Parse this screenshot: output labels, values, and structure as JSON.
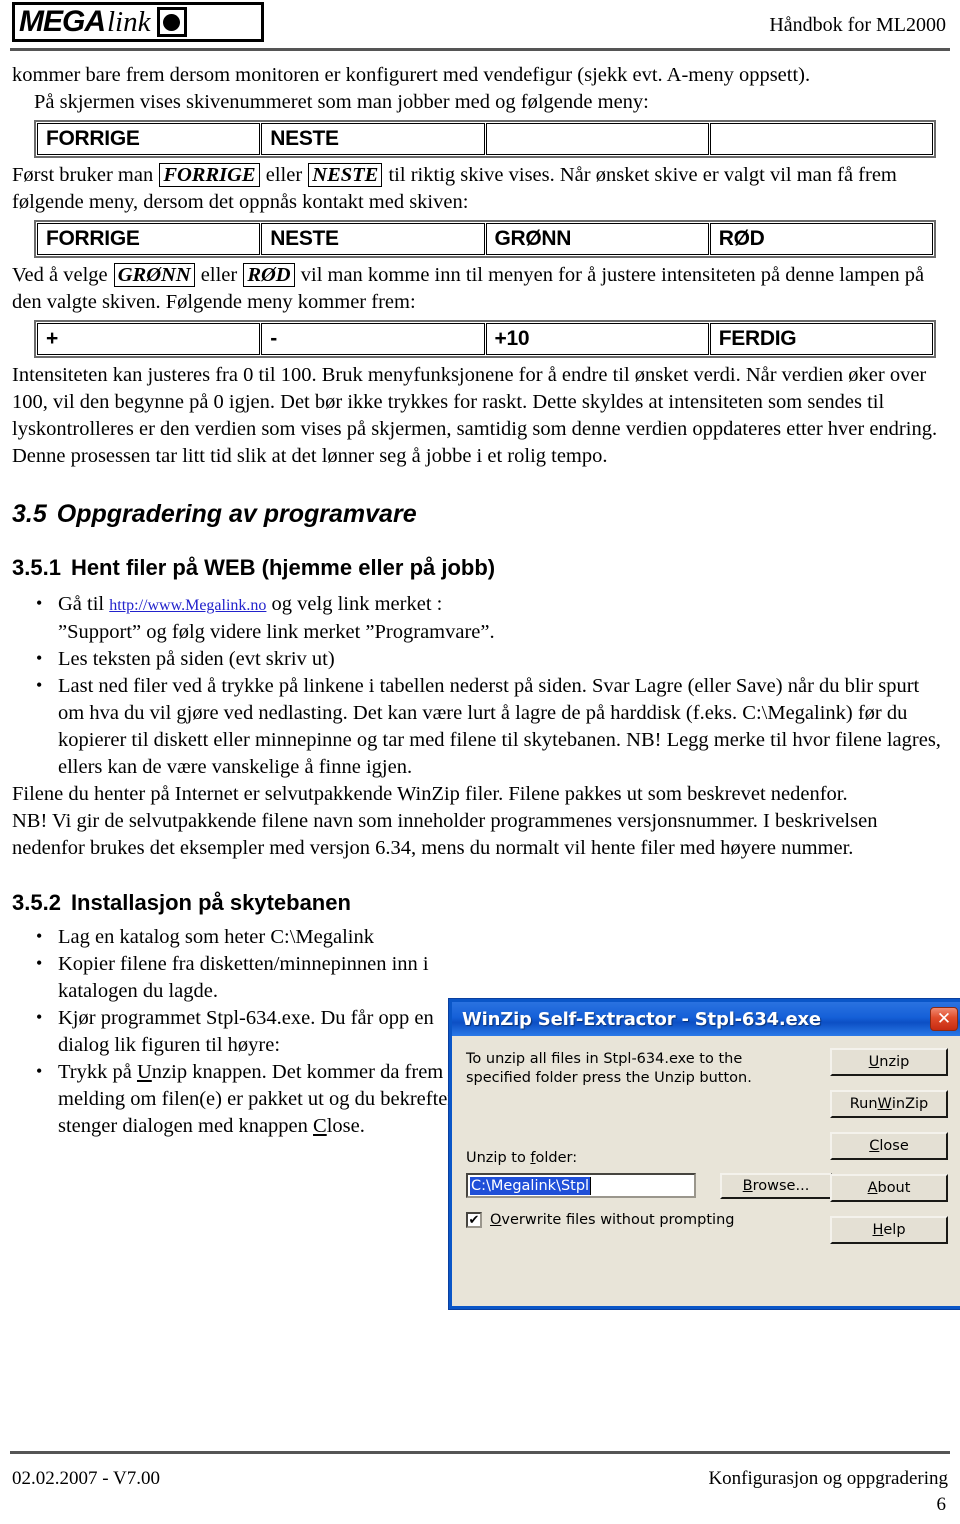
{
  "header": {
    "logo_mega": "MEGA",
    "logo_link": "link",
    "logo_mark_name": "filled-circle-mark",
    "right_text": "Håndbok for ML2000"
  },
  "intro": {
    "line1": "kommer bare frem dersom monitoren er konfigurert med vendefigur (sjekk evt. A-meny oppsett).",
    "line2": "På skjermen vises skivenummeret som man jobber med og følgende meny:"
  },
  "menu_table_1": {
    "cells": [
      "FORRIGE",
      "NESTE",
      "",
      ""
    ]
  },
  "para_after_table1": {
    "pre": "Først bruker man ",
    "box1": "FORRIGE",
    "mid": " eller ",
    "box2": "NESTE",
    "post": " til riktig skive vises. Når ønsket skive er valgt vil man få frem følgende meny, dersom det oppnås kontakt med skiven:"
  },
  "menu_table_2": {
    "cells": [
      "FORRIGE",
      "NESTE",
      "GRØNN",
      "RØD"
    ]
  },
  "para_after_table2": {
    "pre": "Ved å velge ",
    "box1": "GRØNN",
    "mid": " eller ",
    "box2": "RØD",
    "post": " vil man komme inn til menyen for å justere intensiteten på denne lampen på den valgte skiven. Følgende meny kommer frem:"
  },
  "menu_table_3": {
    "cells": [
      "+",
      "-",
      "+10",
      "FERDIG"
    ]
  },
  "para_after_table3": "Intensiteten kan justeres fra 0 til 100. Bruk menyfunksjonene for å endre til ønsket verdi. Når verdien øker over 100, vil den begynne på 0 igjen. Det bør ikke trykkes for raskt. Dette skyldes at intensiteten som sendes til lyskontrolleres er den verdien som vises på skjermen, samtidig som denne verdien oppdateres etter hver endring. Denne prosessen tar litt tid slik at det lønner seg å jobbe i et rolig tempo.",
  "section_35": {
    "number": "3.5",
    "title": "Oppgradering av programvare"
  },
  "section_351": {
    "number": "3.5.1",
    "title": "Hent filer på WEB (hjemme eller på jobb)",
    "bullet1_pre": "Gå til ",
    "bullet1_link": "http://www.Megalink.no",
    "bullet1_post": " og velg link merket :",
    "bullet1_line2": "”Support” og følg videre link merket ”Programvare”.",
    "bullet2": "Les teksten på siden (evt skriv ut)",
    "bullet3": "Last ned filer ved å trykke på linkene i tabellen nederst på siden. Svar Lagre (eller Save) når du blir spurt om hva du vil gjøre ved nedlasting. Det kan være lurt å lagre de på harddisk (f.eks. C:\\Megalink) før du kopierer til diskett eller minnepinne og tar med filene til skytebanen. NB! Legg merke til hvor filene lagres, ellers kan de være vanskelige å finne igjen.",
    "para1": "Filene du henter på Internet er selvutpakkende WinZip filer. Filene pakkes ut som beskrevet nedenfor.",
    "para2": "NB! Vi gir de selvutpakkende filene navn som inneholder programmenes versjonsnummer. I beskrivelsen nedenfor brukes det eksempler med versjon 6.34, mens du normalt vil hente filer med høyere nummer."
  },
  "section_352": {
    "number": "3.5.2",
    "title": "Installasjon på skytebanen",
    "bullet1": "Lag en katalog som heter C:\\Megalink",
    "bullet2": "Kopier filene fra disketten/minnepinnen inn i katalogen du lagde.",
    "bullet3": "Kjør programmet Stpl-634.exe. Du får opp en dialog lik figuren til høyre:",
    "bullet4_pre": "Trykk på ",
    "bullet4_u1": "U",
    "bullet4_mid": "nzip knappen. Det kommer da frem en melding om filen(e) er pakket ut og du bekrefter og stenger dialogen med knappen ",
    "bullet4_u2": "C",
    "bullet4_post": "lose."
  },
  "winzip_dialog": {
    "title": "WinZip Self-Extractor - Stpl-634.exe",
    "close_label": "✕",
    "message": "To unzip all files in Stpl-634.exe to the specified folder press the Unzip button.",
    "folder_label_u": "f",
    "folder_label_pre": "Unzip to ",
    "folder_label_post": "older:",
    "folder_value": "C:\\Megalink\\Stpl",
    "checkbox_checked": true,
    "checkbox_mark": "✔",
    "checkbox_label_u": "O",
    "checkbox_label_post": "verwrite files without prompting",
    "buttons": [
      {
        "u": "U",
        "rest": "nzip",
        "pre": ""
      },
      {
        "u": "W",
        "rest": "inZip",
        "pre": "Run "
      },
      {
        "u": "C",
        "rest": "lose",
        "pre": ""
      },
      {
        "u": "A",
        "rest": "bout",
        "pre": ""
      },
      {
        "u": "H",
        "rest": "elp",
        "pre": ""
      }
    ],
    "browse_label_pre": "",
    "browse_label_u": "B",
    "browse_label_post": "rowse...",
    "accent_titlebar": "#1560d8",
    "accent_close": "#c62b12",
    "face_color": "#e8e4d8"
  },
  "footer": {
    "left": "02.02.2007 - V7.00",
    "right": "Konfigurasjon og oppgradering",
    "page": "6"
  }
}
